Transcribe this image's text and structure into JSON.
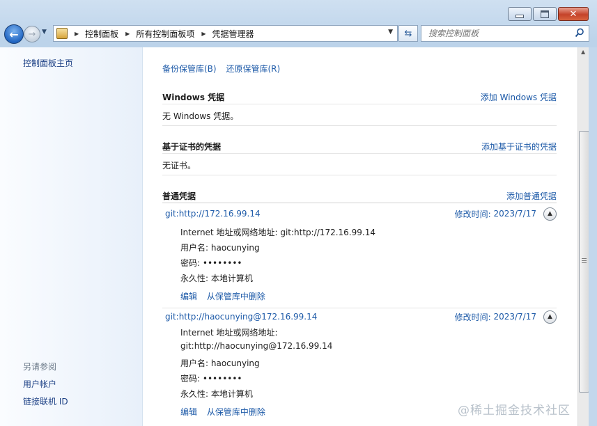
{
  "window": {
    "controls": [
      "minimize",
      "maximize",
      "close"
    ]
  },
  "address_bar": {
    "crumbs": [
      "控制面板",
      "所有控制面板项",
      "凭据管理器"
    ]
  },
  "search": {
    "placeholder": "搜索控制面板"
  },
  "sidebar": {
    "home": "控制面板主页",
    "see_also": "另请参阅",
    "links": [
      "用户帐户",
      "链接联机 ID"
    ]
  },
  "main": {
    "top_links": [
      "备份保管库(B)",
      "还原保管库(R)"
    ],
    "windows": {
      "title": "Windows 凭据",
      "add": "添加 Windows 凭据",
      "empty": "无 Windows 凭据。"
    },
    "cert": {
      "title": "基于证书的凭据",
      "add": "添加基于证书的凭据",
      "empty": "无证书。"
    },
    "generic": {
      "title": "普通凭据",
      "add": "添加普通凭据"
    },
    "credentials": [
      {
        "name": "git:http://172.16.99.14",
        "modified_label": "修改时间:",
        "modified_date": "2023/7/17",
        "address_label": "Internet 地址或网络地址:",
        "address": "git:http://172.16.99.14",
        "user_label": "用户名:",
        "user": "haocunying",
        "password_label": "密码:",
        "password": "••••••••",
        "persistence_label": "永久性:",
        "persistence": "本地计算机",
        "edit": "编辑",
        "remove": "从保管库中删除"
      },
      {
        "name": "git:http://haocunying@172.16.99.14",
        "modified_label": "修改时间:",
        "modified_date": "2023/7/17",
        "address_label": "Internet 地址或网络地址:",
        "address": "git:http://haocunying@172.16.99.14",
        "user_label": "用户名:",
        "user": "haocunying",
        "password_label": "密码:",
        "password": "••••••••",
        "persistence_label": "永久性:",
        "persistence": "本地计算机",
        "edit": "编辑",
        "remove": "从保管库中删除"
      }
    ]
  },
  "watermark": "@稀土掘金技术社区",
  "colors": {
    "link": "#1d5aa8",
    "sidebar_link": "#1b3f84"
  }
}
